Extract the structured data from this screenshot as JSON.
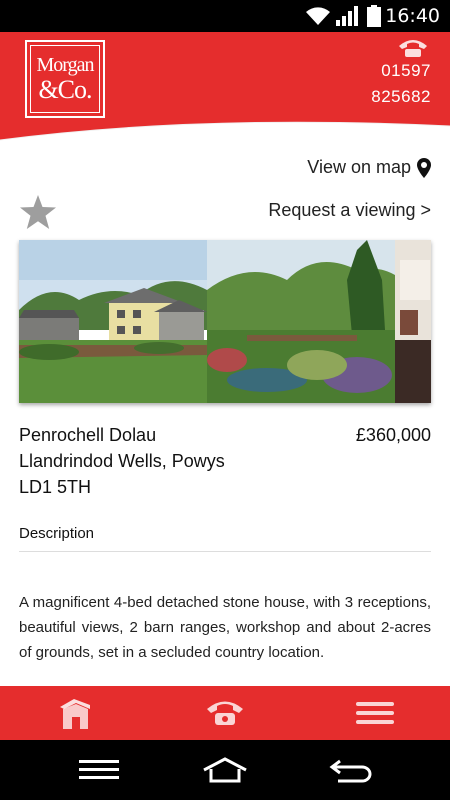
{
  "status_bar": {
    "time": "16:40"
  },
  "header": {
    "logo_line1": "Morgan",
    "logo_line2": "&Co.",
    "phone_line1": "01597",
    "phone_line2": "825682"
  },
  "actions": {
    "view_on_map": "View on map",
    "request_viewing": "Request a viewing >"
  },
  "property": {
    "address_line1": "Penrochell Dolau",
    "address_line2": "Llandrindod Wells, Powys",
    "address_line3": "LD1 5TH",
    "price": "£360,000",
    "description_heading": "Description",
    "description": "A magnificent 4-bed detached stone house, with 3 receptions, beautiful views, 2 barn ranges, workshop and about 2-acres of grounds, set in a secluded country location."
  },
  "tabs": [
    {
      "icon": "home-icon"
    },
    {
      "icon": "phone-icon"
    },
    {
      "icon": "menu-icon"
    }
  ],
  "system_nav": [
    {
      "icon": "menu-icon"
    },
    {
      "icon": "home-icon"
    },
    {
      "icon": "back-icon"
    }
  ],
  "colors": {
    "brand_red": "#e52d2d",
    "icon_grey": "#9e9e9e"
  }
}
